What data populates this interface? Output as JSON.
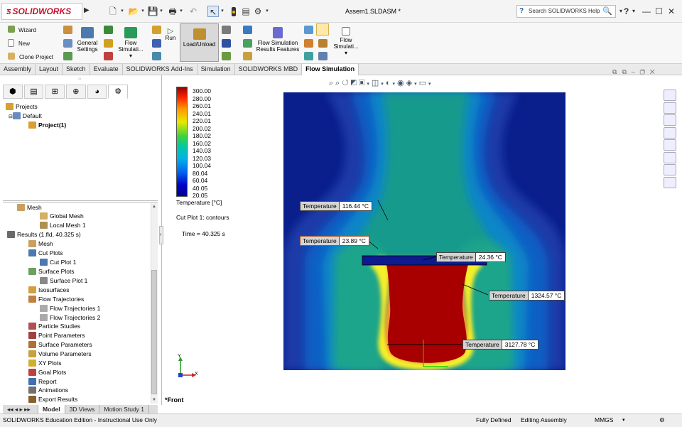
{
  "app": {
    "logo_text": "SOLIDWORKS",
    "document_title": "Assem1.SLDASM *",
    "help_search_placeholder": "Search SOLIDWORKS Help"
  },
  "ribbon": {
    "wizard": "Wizard",
    "new": "New",
    "clone_project": "Clone Project",
    "general_settings_l1": "General",
    "general_settings_l2": "Settings",
    "flow_sim_l1": "Flow",
    "flow_sim_l2": "Simulati...",
    "run": "Run",
    "load_unload": "Load/Unload",
    "results_features_l1": "Flow Simulation",
    "results_features_l2": "Results Features",
    "flow_sim2_l1": "Flow",
    "flow_sim2_l2": "Simulati..."
  },
  "tabs": [
    "Assembly",
    "Layout",
    "Sketch",
    "Evaluate",
    "SOLIDWORKS Add-Ins",
    "Simulation",
    "SOLIDWORKS MBD",
    "Flow Simulation"
  ],
  "active_tab": "Flow Simulation",
  "tree_top": {
    "projects": "Projects",
    "default": "Default",
    "project1": "Project(1)"
  },
  "tree_bottom": {
    "mesh": "Mesh",
    "global_mesh": "Global Mesh",
    "local_mesh": "Local Mesh 1",
    "results": "Results (1.fld, 40.325 s)",
    "res_mesh": "Mesh",
    "cut_plots": "Cut Plots",
    "cut_plot1": "Cut Plot 1",
    "surface_plots": "Surface Plots",
    "surface_plot1": "Surface Plot 1",
    "isosurfaces": "Isosurfaces",
    "flow_trajectories": "Flow Trajectories",
    "flow_traj1": "Flow Trajectories 1",
    "flow_traj2": "Flow Trajectories 2",
    "particle_studies": "Particle Studies",
    "point_params": "Point Parameters",
    "surface_params": "Surface Parameters",
    "volume_params": "Volume Parameters",
    "xy_plots": "XY Plots",
    "goal_plots": "Goal Plots",
    "report": "Report",
    "animations": "Animations",
    "export_results": "Export Results"
  },
  "bottom_tabs": [
    "Model",
    "3D Views",
    "Motion Study 1"
  ],
  "legend": {
    "values": [
      "300.00",
      "280.00",
      "260.01",
      "240.01",
      "220.01",
      "200.02",
      "180.02",
      "160.02",
      "140.03",
      "120.03",
      "100.04",
      "80.04",
      "60.04",
      "40.05",
      "20.05"
    ],
    "unit_label": "Temperature [°C]",
    "plot_label": "Cut Plot 1: contours",
    "time_label": "Time = 40.325 s"
  },
  "probes": [
    {
      "label": "Temperature",
      "value": "116.44 °C"
    },
    {
      "label": "Temperature",
      "value": "23.89 °C"
    },
    {
      "label": "Temperature",
      "value": "24.36 °C"
    },
    {
      "label": "Temperature",
      "value": "1324.57 °C"
    },
    {
      "label": "Temperature",
      "value": "3127.78 °C"
    }
  ],
  "view": {
    "name": "*Front",
    "axis_x": "X",
    "axis_y": "Y"
  },
  "status": {
    "left": "SOLIDWORKS Education Edition - Instructional Use Only",
    "fully_defined": "Fully Defined",
    "editing": "Editing Assembly",
    "units": "MMGS"
  },
  "colors": {
    "accent": "#c8102e",
    "plot_bg": "#0a1e8c",
    "hot": "#a80000"
  }
}
